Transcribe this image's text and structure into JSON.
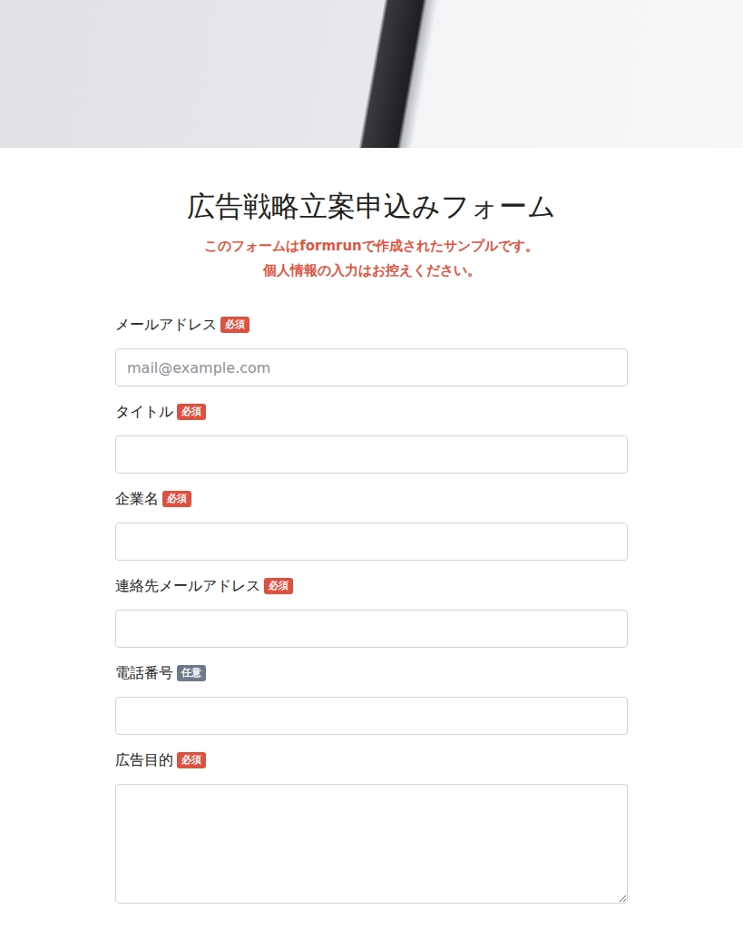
{
  "title": "広告戦略立案申込みフォーム",
  "notice": [
    "このフォームはformrunで作成されたサンプルです。",
    "個人情報の入力はお控えください。"
  ],
  "fields": [
    {
      "label": "メールアドレス",
      "badge": "必須",
      "required": true,
      "kind": "input",
      "placeholder": "mail@example.com"
    },
    {
      "label": "タイトル",
      "badge": "必須",
      "required": true,
      "kind": "input",
      "placeholder": ""
    },
    {
      "label": "企業名",
      "badge": "必須",
      "required": true,
      "kind": "input",
      "placeholder": ""
    },
    {
      "label": "連絡先メールアドレス",
      "badge": "必須",
      "required": true,
      "kind": "input",
      "placeholder": ""
    },
    {
      "label": "電話番号",
      "badge": "任意",
      "required": false,
      "kind": "input",
      "placeholder": ""
    },
    {
      "label": "広告目的",
      "badge": "必須",
      "required": true,
      "kind": "textarea",
      "placeholder": ""
    }
  ]
}
